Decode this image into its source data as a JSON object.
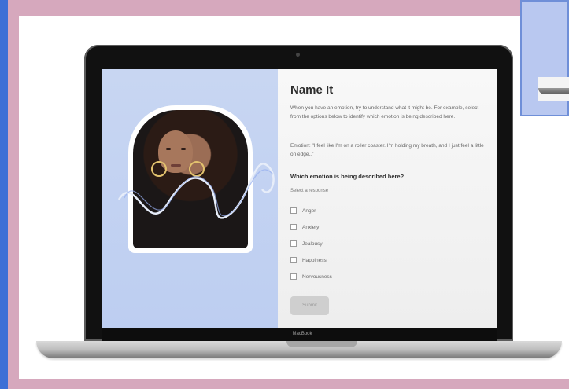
{
  "screen": {
    "title": "Name It",
    "intro": "When you have an emotion, try to understand what it might be. For example, select from the options below to identify which emotion is being described here.",
    "emotion": "Emotion: \"I feel like I'm on a roller coaster. I'm holding my breath, and I just feel a little on edge..\"",
    "question": "Which emotion is being described here?",
    "select_prompt": "Select a response",
    "options": [
      "Anger",
      "Anxiety",
      "Jealousy",
      "Happiness",
      "Nervousness"
    ],
    "submit": "Submit"
  },
  "device": {
    "brand": "MacBook"
  },
  "colors": {
    "background_blue": "#3d6fd6",
    "frame_pink": "#d6a8bd",
    "screen_blue": "#c8d6f2"
  }
}
